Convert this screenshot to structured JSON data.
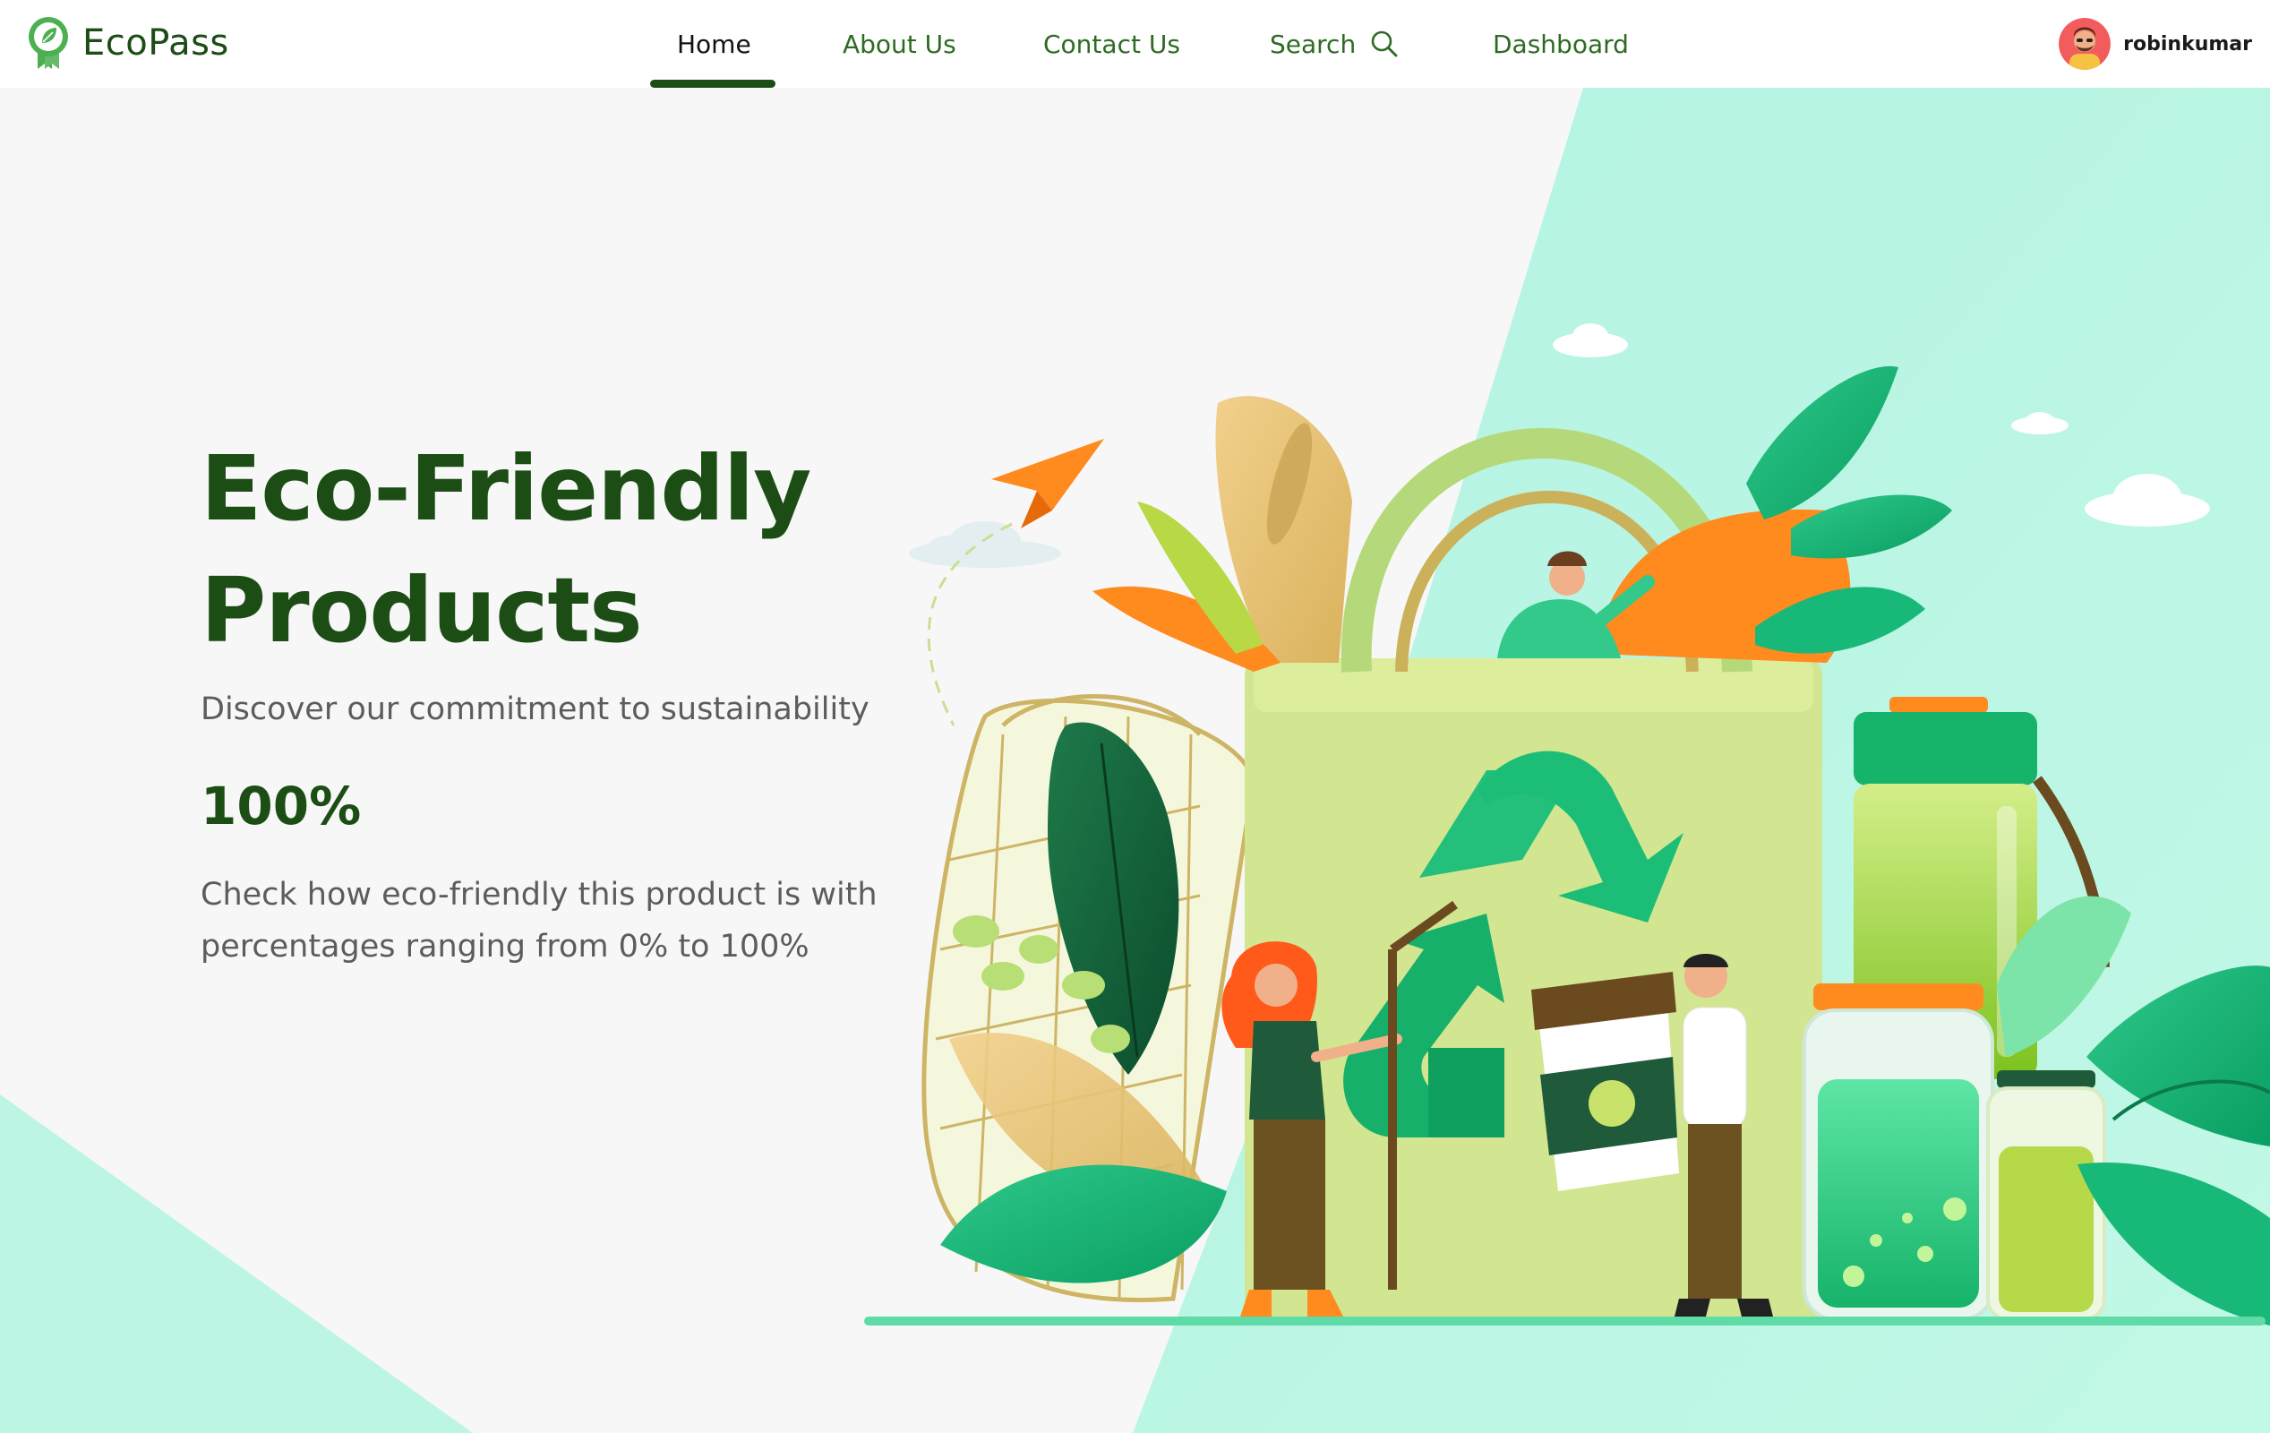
{
  "app": {
    "name": "EcoPass"
  },
  "nav": {
    "items": [
      {
        "label": "Home",
        "active": true
      },
      {
        "label": "About Us",
        "active": false
      },
      {
        "label": "Contact Us",
        "active": false
      },
      {
        "label": "Search",
        "active": false,
        "icon": "search-icon"
      },
      {
        "label": "Dashboard",
        "active": false
      }
    ]
  },
  "user": {
    "name": "robinkumar",
    "avatar_icon": "user-avatar"
  },
  "hero": {
    "title_line1": "Eco-Friendly",
    "title_line2": "Products",
    "subtitle": "Discover our commitment to sustainability",
    "stat": "100%",
    "description_line1": "Check how eco-friendly this product is with",
    "description_line2": "percentages ranging from 0% to 100%"
  },
  "colors": {
    "brand_dark_green": "#1b4d14",
    "nav_green": "#2e6b22",
    "mint": "#b9f5e4",
    "body_text": "#5c5c5c"
  }
}
